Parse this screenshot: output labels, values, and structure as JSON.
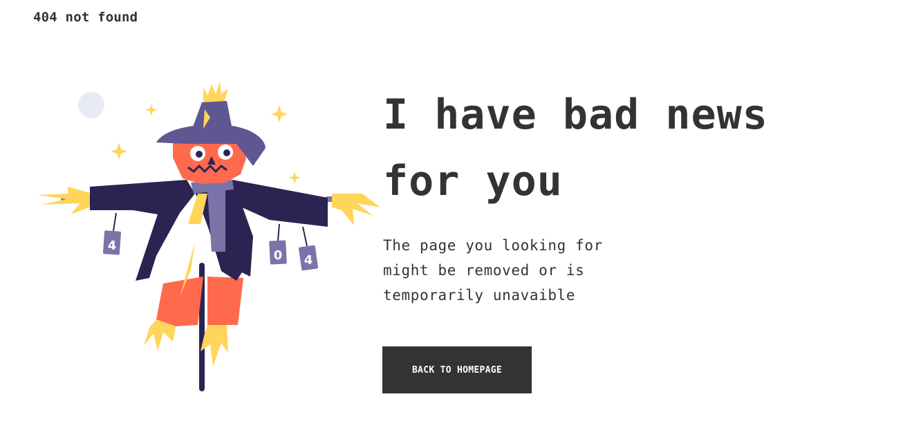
{
  "header": {
    "site_label": "404 not found"
  },
  "main": {
    "headline_line1": "I have bad news",
    "headline_line2": "for you",
    "description_line1": "The page you looking for",
    "description_line2": "might be removed or is",
    "description_line3": "temporarily unavaible",
    "button_label": "BACK TO HOMEPAGE"
  },
  "illustration": {
    "can_left_digit": "4",
    "can_middle_digit": "0",
    "can_right_digit": "4"
  },
  "colors": {
    "text": "#333333",
    "button_bg": "#333333",
    "button_text": "#ffffff",
    "coat": "#2b2452",
    "hat": "#5e5791",
    "scarf": "#7b74a8",
    "face": "#ff6a4d",
    "straw": "#ffd55a",
    "moon": "#e8ebf5"
  }
}
